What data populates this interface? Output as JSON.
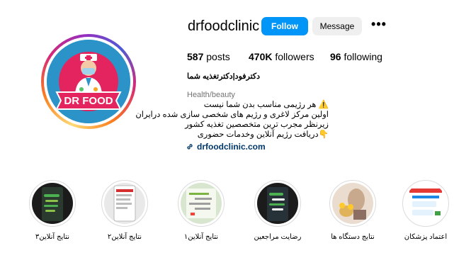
{
  "profile": {
    "username": "drfoodclinic",
    "follow_label": "Follow",
    "message_label": "Message",
    "more_label": "•••",
    "logo_text": "DR FOOD",
    "stats": {
      "posts_count": "587",
      "posts_label": "posts",
      "followers_count": "470K",
      "followers_label": "followers",
      "following_count": "96",
      "following_label": "following"
    },
    "display_name": "دکترفود|دکترتغذیه شما",
    "category": "Health/beauty",
    "bio_lines": [
      "⚠️ هر رژیمی مناسب بدن شما نیست",
      "اولین مرکز لاغری و رژیم های شخصی سازی شده درایران",
      "زیرنظر مجرب ترین متخصصین تغذیه کشور",
      "👇دریافت رژیم آنلاین وخدمات حضوری"
    ],
    "website": "drfoodclinic.com"
  },
  "highlights": [
    {
      "label": "نتایج آنلاین۳"
    },
    {
      "label": "نتایج آنلاین۲"
    },
    {
      "label": "نتایج آنلاین۱"
    },
    {
      "label": "رضایت مراجعین"
    },
    {
      "label": "نتایج دستگاه ها"
    },
    {
      "label": "اعتماد پزشکان"
    }
  ],
  "colors": {
    "follow_blue": "#0095f6",
    "link_blue": "#00376b",
    "muted_gray": "#737373",
    "logo_pink": "#e4245f",
    "logo_blue": "#2c93c9"
  }
}
